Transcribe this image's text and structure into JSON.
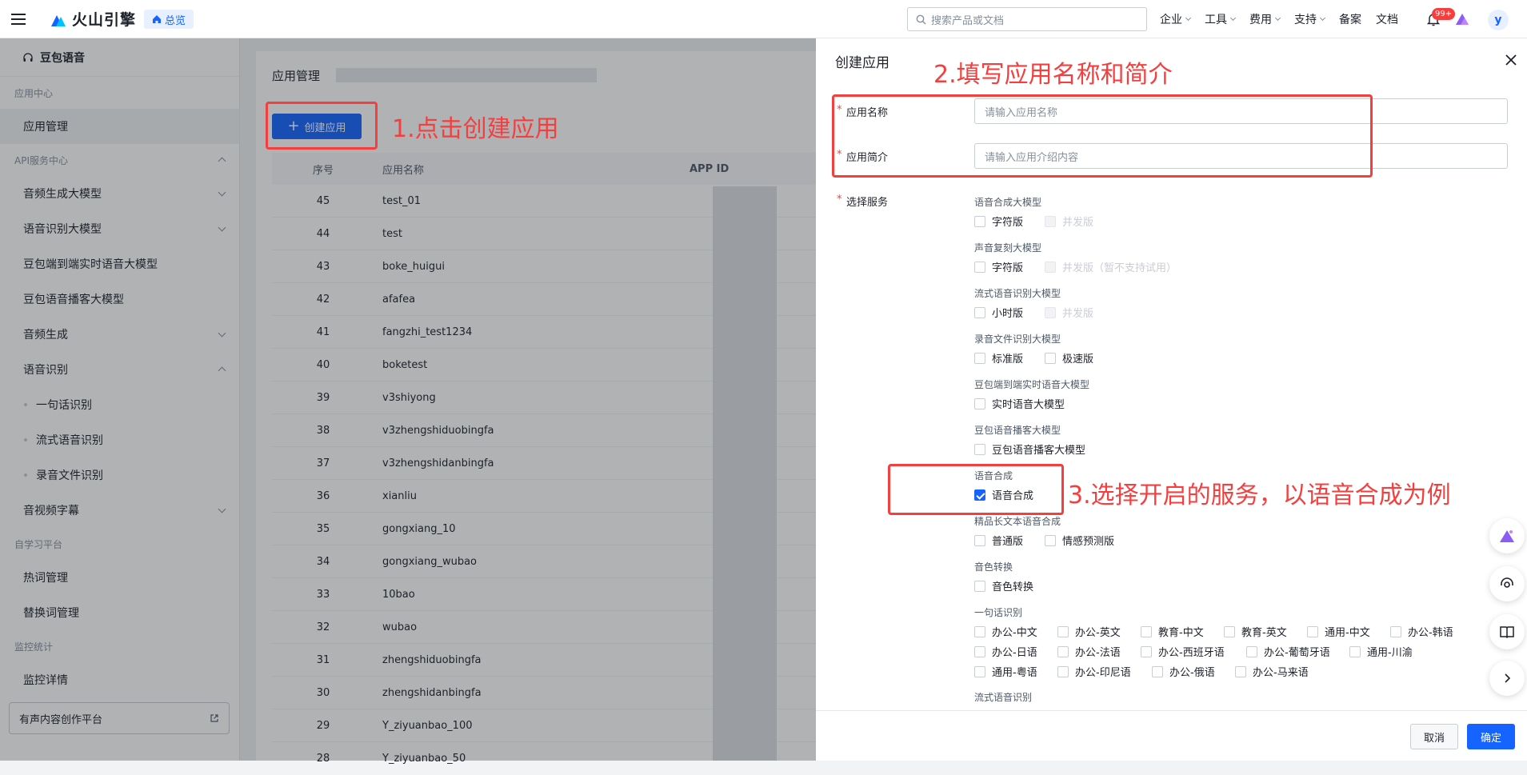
{
  "topbar": {
    "brand": "火山引擎",
    "overview": "总览",
    "search_placeholder": "搜索产品或文档",
    "nav": [
      "企业",
      "工具",
      "费用",
      "支持"
    ],
    "nav_plain": [
      "备案",
      "文档"
    ],
    "badge": "99+",
    "avatar": "y"
  },
  "sidebar": {
    "title": "豆包语音",
    "groups": {
      "app_center": "应用中心",
      "api_center": "API服务中心",
      "self_learning": "自学习平台",
      "monitor": "监控统计"
    },
    "items": {
      "app_manage": "应用管理",
      "audio_gen_model": "音频生成大模型",
      "asr_model": "语音识别大模型",
      "e2e_realtime": "豆包端到端实时语音大模型",
      "podcast": "豆包语音播客大模型",
      "audio_gen": "音频生成",
      "asr": "语音识别",
      "one_sentence": "一句话识别",
      "stream_asr": "流式语音识别",
      "file_asr": "录音文件识别",
      "av_subtitle": "音视频字幕",
      "hotword": "热词管理",
      "replace_word": "替换词管理",
      "monitor_detail": "监控详情"
    },
    "footer": "有声内容创作平台"
  },
  "main": {
    "title": "应用管理",
    "create_button": "创建应用",
    "columns": [
      "序号",
      "应用名称",
      "APP ID"
    ],
    "rows": [
      [
        "45",
        "test_01"
      ],
      [
        "44",
        "test"
      ],
      [
        "43",
        "boke_huigui"
      ],
      [
        "42",
        "afafea"
      ],
      [
        "41",
        "fangzhi_test1234"
      ],
      [
        "40",
        "boketest"
      ],
      [
        "39",
        "v3shiyong"
      ],
      [
        "38",
        "v3zhengshiduobingfa"
      ],
      [
        "37",
        "v3zhengshidanbingfa"
      ],
      [
        "36",
        "xianliu"
      ],
      [
        "35",
        "gongxiang_10"
      ],
      [
        "34",
        "gongxiang_wubao"
      ],
      [
        "33",
        "10bao"
      ],
      [
        "32",
        "wubao"
      ],
      [
        "31",
        "zhengshiduobingfa"
      ],
      [
        "30",
        "zhengshidanbingfa"
      ],
      [
        "29",
        "Y_ziyuanbao_100"
      ],
      [
        "28",
        "Y_ziyuanbao_50"
      ]
    ]
  },
  "drawer": {
    "title": "创建应用",
    "name_label": "应用名称",
    "name_placeholder": "请输入应用名称",
    "desc_label": "应用简介",
    "desc_placeholder": "请输入应用介绍内容",
    "service_label": "选择服务",
    "groups": {
      "tts_model": "语音合成大模型",
      "voice_clone": "声音复刻大模型",
      "stream_asr_model": "流式语音识别大模型",
      "file_asr_model": "录音文件识别大模型",
      "e2e": "豆包端到端实时语音大模型",
      "podcast": "豆包语音播客大模型",
      "tts": "语音合成",
      "long_tts": "精品长文本语音合成",
      "vc": "音色转换",
      "one_sentence": "一句话识别",
      "stream_asr": "流式语音识别"
    },
    "options": {
      "char": "字符版",
      "concurrent": "并发版",
      "char2": "字符版",
      "concurrent_unsupported": "并发版（暂不支持试用）",
      "hour": "小时版",
      "concurrent3": "并发版",
      "standard": "标准版",
      "fast": "极速版",
      "realtime": "实时语音大模型",
      "podcast": "豆包语音播客大模型",
      "tts": "语音合成",
      "normal": "普通版",
      "emotion": "情感预测版",
      "vc": "音色转换",
      "asr_row1": [
        "办公-中文",
        "办公-英文",
        "教育-中文",
        "教育-英文",
        "通用-中文",
        "办公-韩语"
      ],
      "asr_row2": [
        "办公-日语",
        "办公-法语",
        "办公-西班牙语",
        "办公-葡萄牙语",
        "通用-川渝"
      ],
      "asr_row3": [
        "通用-粤语",
        "办公-印尼语",
        "办公-俄语",
        "办公-马来语"
      ]
    },
    "cancel": "取消",
    "confirm": "确定"
  },
  "annotations": {
    "step1": "1.点击创建应用",
    "step2": "2.填写应用名称和简介",
    "step3": "3.选择开启的服务，以语音合成为例",
    "color": "#f53f3f"
  },
  "accent_color": "#1664ff"
}
